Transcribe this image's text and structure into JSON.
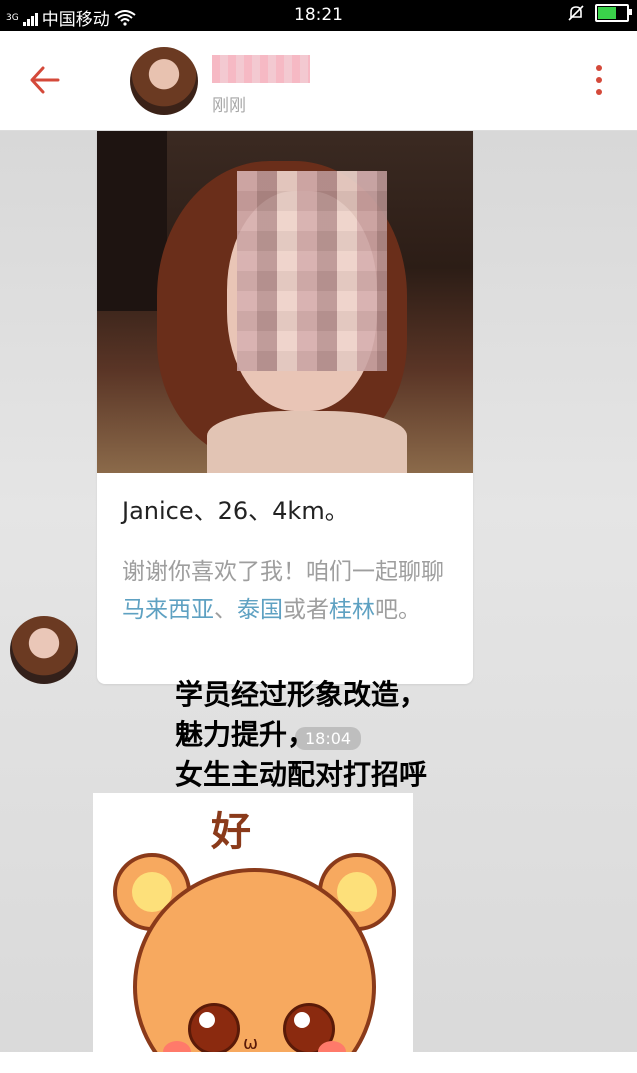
{
  "status_bar": {
    "network_type": "3G",
    "carrier": "中国移动",
    "time": "18:21",
    "icons": [
      "signal-icon",
      "wifi-icon",
      "mute-bell-icon",
      "battery-icon"
    ]
  },
  "header": {
    "contact_status": "刚刚",
    "icons": [
      "back-arrow-icon",
      "more-vertical-icon"
    ],
    "accent_color": "#d4493a"
  },
  "chat": {
    "profile_card": {
      "name_line": "Janice、26、4km。",
      "message_parts": {
        "p1": "谢谢你喜欢了我！咱们一起聊聊",
        "link1": "马来西亚",
        "p2": "、",
        "link2": "泰国",
        "p3": "或者",
        "link3": "桂林",
        "p4": "吧。"
      },
      "link_color": "#5ea1c2"
    },
    "time_label": "18:04",
    "overlay_lines": [
      "学员经过形象改造，",
      "魅力提升，",
      "女生主动配对打招呼"
    ],
    "sticker": {
      "word": "好"
    }
  }
}
